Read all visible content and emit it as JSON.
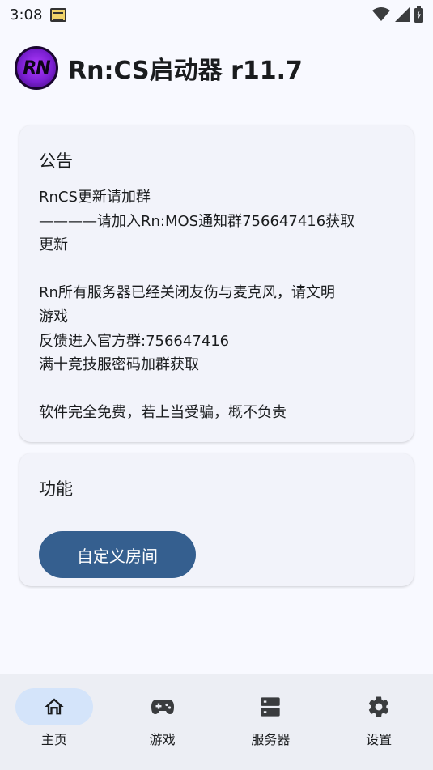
{
  "status_bar": {
    "time": "3:08",
    "icons": [
      "notification-icon",
      "wifi-icon",
      "signal-icon",
      "battery-icon"
    ]
  },
  "app": {
    "logo_text": "RN",
    "title": "Rn:CS启动器 r11.7"
  },
  "announcement": {
    "title": "公告",
    "lines": [
      "RnCS更新请加群",
      "————请加入Rn:MOS通知群756647416获取",
      "更新",
      "",
      "Rn所有服务器已经关闭友伤与麦克风，请文明",
      "游戏",
      "反馈进入官方群:756647416",
      "满十竞技服密码加群获取",
      "",
      "软件完全免费，若上当受骗，概不负责"
    ]
  },
  "features": {
    "title": "功能",
    "custom_room_label": "自定义房间"
  },
  "bottom_nav": {
    "items": [
      {
        "label": "主页",
        "icon": "home-icon",
        "active": true
      },
      {
        "label": "游戏",
        "icon": "gamepad-icon",
        "active": false
      },
      {
        "label": "服务器",
        "icon": "server-icon",
        "active": false
      },
      {
        "label": "设置",
        "icon": "gear-icon",
        "active": false
      }
    ]
  },
  "colors": {
    "background": "#f8f9ff",
    "card": "#f2f3fa",
    "primary_button": "#355f8f",
    "nav_active": "#d4e4fa",
    "nav_bar": "#eceef4"
  }
}
